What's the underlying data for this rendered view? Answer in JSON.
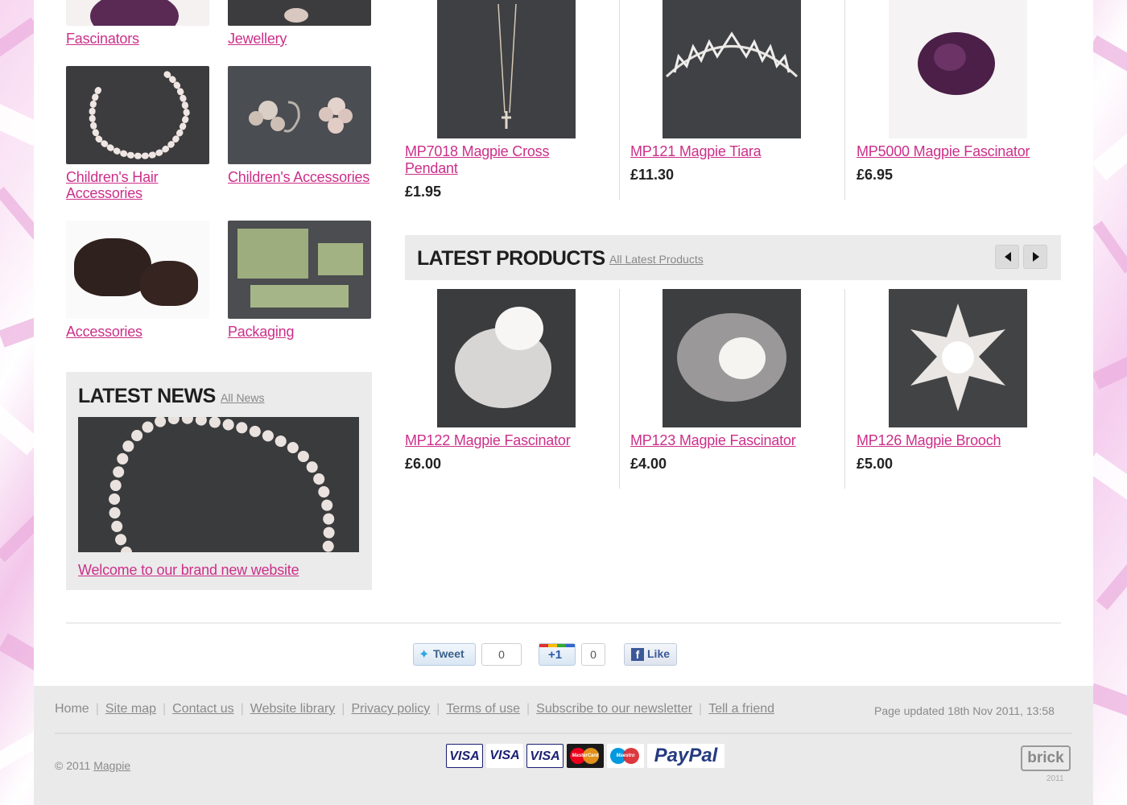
{
  "categories": [
    {
      "label": "Fascinators"
    },
    {
      "label": "Jewellery"
    },
    {
      "label": "Children's Hair Accessories"
    },
    {
      "label": "Children's Accessories"
    },
    {
      "label": "Accessories"
    },
    {
      "label": "Packaging"
    }
  ],
  "featured_products": [
    {
      "name": "MP7018 Magpie Cross Pendant",
      "price": "£1.95"
    },
    {
      "name": "MP121 Magpie Tiara",
      "price": "£11.30"
    },
    {
      "name": "MP5000 Magpie Fascinator",
      "price": "£6.95"
    }
  ],
  "latest_products": {
    "title": "LATEST PRODUCTS",
    "all_link": "All Latest Products",
    "items": [
      {
        "name": "MP122 Magpie Fascinator",
        "price": "£6.00"
      },
      {
        "name": "MP123 Magpie Fascinator",
        "price": "£4.00"
      },
      {
        "name": "MP126 Magpie Brooch",
        "price": "£5.00"
      }
    ]
  },
  "latest_news": {
    "title": "LATEST NEWS",
    "all_link": "All News",
    "headline": "Welcome to our brand new website"
  },
  "social": {
    "tweet_label": "Tweet",
    "tweet_count": "0",
    "plusone_label": "+1",
    "plusone_count": "0",
    "like_label": "Like"
  },
  "footer": {
    "nav": [
      "Home",
      "Site map",
      "Contact us",
      "Website library",
      "Privacy policy",
      "Terms of use",
      "Subscribe to our newsletter",
      "Tell a friend"
    ],
    "updated": "Page updated 18th Nov 2011, 13:58",
    "copyright": "© 2011",
    "brand": "Magpie",
    "payment_cards": [
      "VISA",
      "VISA",
      "VISA",
      "MasterCard",
      "Maestro",
      "PayPal"
    ],
    "builder_logo": "brick",
    "builder_year": "2011"
  },
  "colors": {
    "link": "#cc2f89",
    "panel": "#ebebeb",
    "footer_bg": "#eaeaea",
    "page_bg_accent": "#e9a9dc"
  }
}
